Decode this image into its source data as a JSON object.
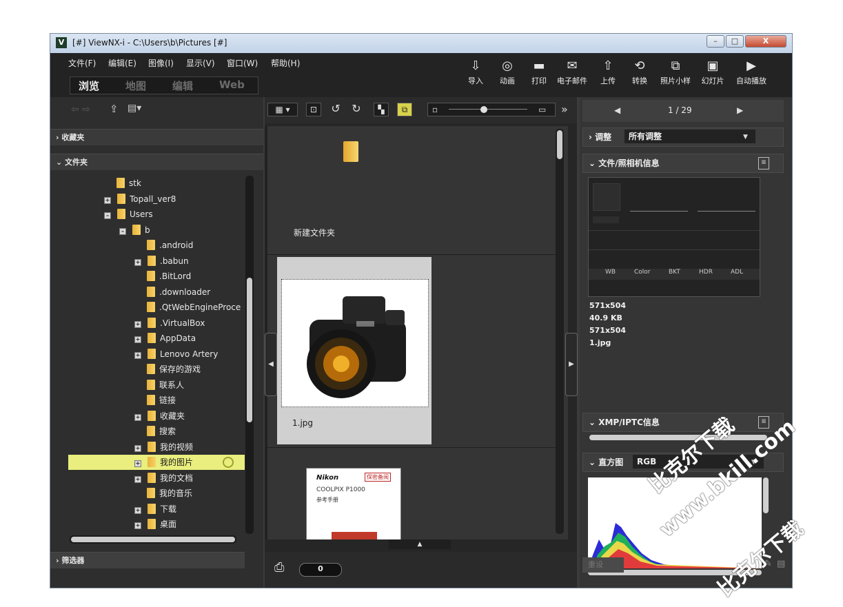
{
  "window": {
    "title": "[#] ViewNX-i - C:\\Users\\b\\Pictures [#]",
    "app_icon": "V",
    "controls": {
      "minimize": "–",
      "maximize": "□",
      "close": "X"
    }
  },
  "menu": [
    "文件(F)",
    "编辑(E)",
    "图像(I)",
    "显示(V)",
    "窗口(W)",
    "帮助(H)"
  ],
  "mode_tabs": [
    {
      "label": "浏览",
      "active": true
    },
    {
      "label": "地图",
      "active": false
    },
    {
      "label": "编辑",
      "active": false
    },
    {
      "label": "Web",
      "active": false
    }
  ],
  "toolbar": [
    {
      "label": "导入",
      "icon": "import-icon",
      "glyph": "⇩"
    },
    {
      "label": "动画",
      "icon": "movie-icon",
      "glyph": "◎"
    },
    {
      "label": "打印",
      "icon": "print-icon",
      "glyph": "▬"
    },
    {
      "label": "电子邮件",
      "icon": "email-icon",
      "glyph": "✉"
    },
    {
      "label": "上传",
      "icon": "upload-icon",
      "glyph": "⇧"
    },
    {
      "label": "转换",
      "icon": "convert-icon",
      "glyph": "⟲"
    },
    {
      "label": "照片小样",
      "icon": "contact-sheet-icon",
      "glyph": "⧉"
    },
    {
      "label": "幻灯片",
      "icon": "slideshow-icon",
      "glyph": "▣"
    },
    {
      "label": "自动播放",
      "icon": "autoplay-icon",
      "glyph": "▶"
    }
  ],
  "left_panel": {
    "favorites_label": "收藏夹",
    "folders_label": "文件夹",
    "filter_label": "筛选器",
    "tree": [
      {
        "label": "stk",
        "indent": 0,
        "expander": "",
        "selected": false
      },
      {
        "label": "Topall_ver8",
        "indent": 0,
        "expander": "+",
        "selected": false
      },
      {
        "label": "Users",
        "indent": 0,
        "expander": "–",
        "selected": false
      },
      {
        "label": "b",
        "indent": 1,
        "expander": "–",
        "selected": false
      },
      {
        "label": ".android",
        "indent": 2,
        "expander": "",
        "selected": false
      },
      {
        "label": ".babun",
        "indent": 2,
        "expander": "+",
        "selected": false
      },
      {
        "label": ".BitLord",
        "indent": 2,
        "expander": "",
        "selected": false
      },
      {
        "label": ".downloader",
        "indent": 2,
        "expander": "",
        "selected": false
      },
      {
        "label": ".QtWebEngineProce",
        "indent": 2,
        "expander": "",
        "selected": false
      },
      {
        "label": ".VirtualBox",
        "indent": 2,
        "expander": "+",
        "selected": false
      },
      {
        "label": "AppData",
        "indent": 2,
        "expander": "+",
        "selected": false
      },
      {
        "label": "Lenovo Artery",
        "indent": 2,
        "expander": "+",
        "selected": false
      },
      {
        "label": "保存的游戏",
        "indent": 2,
        "expander": "",
        "selected": false
      },
      {
        "label": "联系人",
        "indent": 2,
        "expander": "",
        "selected": false
      },
      {
        "label": "链接",
        "indent": 2,
        "expander": "",
        "selected": false
      },
      {
        "label": "收藏夹",
        "indent": 2,
        "expander": "+",
        "selected": false
      },
      {
        "label": "搜索",
        "indent": 2,
        "expander": "",
        "selected": false
      },
      {
        "label": "我的视频",
        "indent": 2,
        "expander": "+",
        "selected": false
      },
      {
        "label": "我的图片",
        "indent": 2,
        "expander": "+",
        "selected": true
      },
      {
        "label": "我的文档",
        "indent": 2,
        "expander": "+",
        "selected": false
      },
      {
        "label": "我的音乐",
        "indent": 2,
        "expander": "",
        "selected": false
      },
      {
        "label": "下载",
        "indent": 2,
        "expander": "+",
        "selected": false
      },
      {
        "label": "桌面",
        "indent": 2,
        "expander": "+",
        "selected": false
      }
    ]
  },
  "center": {
    "toolbar_glyphs": {
      "view": "▦ ▾",
      "fit": "⊡",
      "rotate_left": "↺",
      "rotate_right": "↻",
      "compare": "▚",
      "multi": "⧉",
      "small": "▫",
      "large": "▭",
      "more": "»"
    },
    "items": [
      {
        "name": "新建文件夹",
        "type": "folder"
      },
      {
        "name": "1.jpg",
        "type": "image",
        "selected": true
      },
      {
        "brand": "Nikon",
        "stamp": "保密备阅",
        "model": "COOLPIX P1000",
        "subtitle": "参考手册",
        "type": "document"
      }
    ],
    "rating_count": "0"
  },
  "right_panel": {
    "nav": {
      "prev": "◀",
      "counter": "1 / 29",
      "next": "▶"
    },
    "adjust_label": "调整",
    "adjust_value": "所有调整",
    "file_info_label": "文件/照相机信息",
    "info_tags": [
      "WB",
      "Color",
      "BKT",
      "HDR",
      "ADL"
    ],
    "info_lines": [
      "571x504",
      "40.9 KB",
      "571x504",
      "1.jpg"
    ],
    "xmp_label": "XMP/IPTC信息",
    "histogram_label": "直方图",
    "histogram_channel": "RGB",
    "reset_label": "重设"
  },
  "watermark": {
    "line1": "比克尔下载",
    "line2": "www.bkill.com",
    "line3": "比克尔下载"
  }
}
